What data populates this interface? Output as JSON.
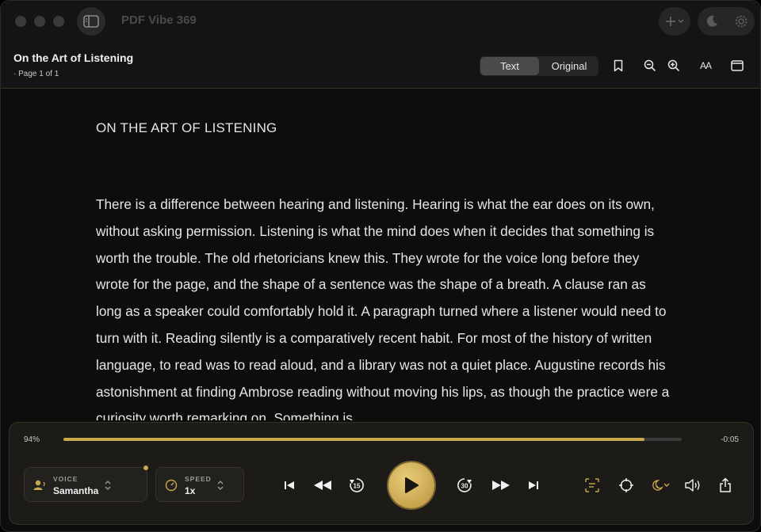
{
  "app": {
    "title": "PDF Vibe 369"
  },
  "document": {
    "title": "On the Art of Listening",
    "page_info": "· Page 1 of 1",
    "view_modes": [
      "Text",
      "Original"
    ],
    "active_view": "Text",
    "heading": "ON THE ART OF LISTENING",
    "body": "There is a difference between hearing and listening. Hearing is what the ear does on its own, without asking permission. Listening is what the mind does when it decides that something is worth the trouble. The old rhetoricians knew this. They wrote for the voice long before they wrote for the page, and the shape of a sentence was the shape of a breath. A clause ran as long as a speaker could comfortably hold it. A paragraph turned where a listener would need to turn with it. Reading silently is a comparatively recent habit. For most of the history of written language, to read was to read aloud, and a library was not a quiet place. Augustine records his astonishment at finding Ambrose reading without moving his lips, as though the practice were a curiosity worth remarking on. Something is"
  },
  "header_icons": [
    "bookmark-icon",
    "zoom-out-icon",
    "zoom-in-icon",
    "text-size-icon",
    "fullscreen-icon"
  ],
  "header_text_size_glyph": "AA",
  "player": {
    "progress_label": "94%",
    "progress_value": 0.94,
    "remaining": "-0:05",
    "voice_label": "VOICE",
    "voice_value": "Samantha",
    "speed_label": "SPEED",
    "speed_value": "1x",
    "skip_back_seconds": "15",
    "skip_forward_seconds": "30"
  },
  "colors": {
    "accent": "#c9a84c",
    "background": "#0d0d0d",
    "text": "#e6e6e6"
  }
}
